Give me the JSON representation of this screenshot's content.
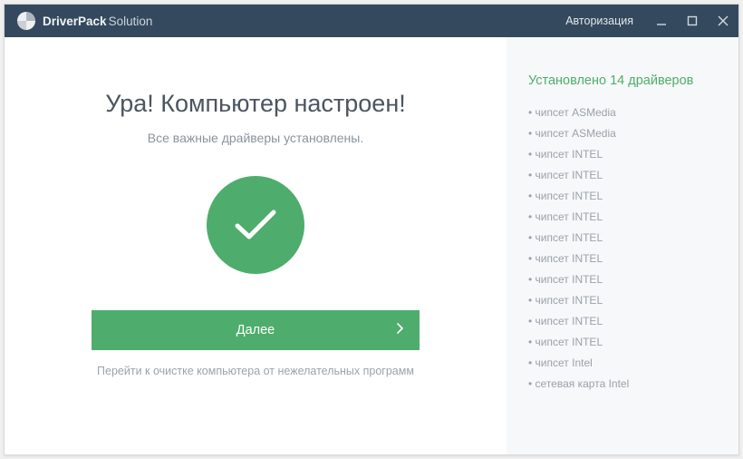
{
  "titlebar": {
    "appNameBold": "DriverPack",
    "appNameLight": "Solution",
    "authLabel": "Авторизация"
  },
  "main": {
    "headline": "Ура! Компьютер настроен!",
    "subhead": "Все важные драйверы установлены.",
    "nextLabel": "Далее",
    "cleanupLabel": "Перейти к очистке компьютера от нежелательных программ"
  },
  "side": {
    "title": "Установлено 14 драйверов",
    "items": [
      "чипсет ASMedia",
      "чипсет ASMedia",
      "чипсет INTEL",
      "чипсет INTEL",
      "чипсет INTEL",
      "чипсет INTEL",
      "чипсет INTEL",
      "чипсет INTEL",
      "чипсет INTEL",
      "чипсет INTEL",
      "чипсет INTEL",
      "чипсет INTEL",
      "чипсет Intel",
      "сетевая карта Intel"
    ]
  },
  "colors": {
    "accent": "#4ead6c",
    "titlebar": "#34495e"
  }
}
